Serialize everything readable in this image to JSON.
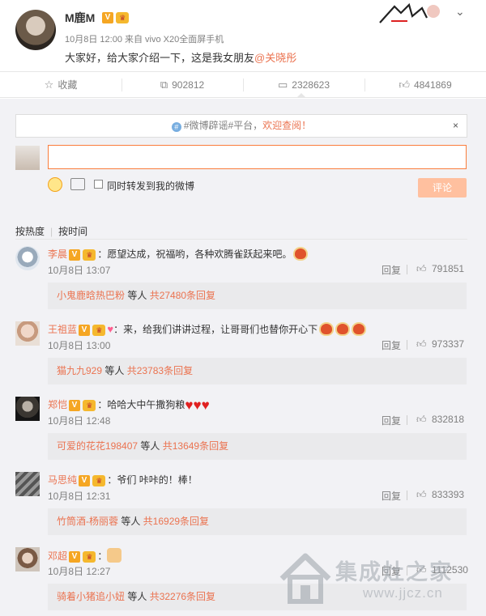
{
  "post": {
    "author": "M鹿M",
    "meta": "10月8日 12:00 来自 vivo X20全面屏手机",
    "text": "大家好，给大家介绍一下，这是我女朋友",
    "mention": "@关晓彤",
    "vip_badge": "V"
  },
  "actions": {
    "favorite": "收藏",
    "repost": "902812",
    "comment": "2328623",
    "like": "4841869"
  },
  "notice": {
    "text_before": "#微博辟谣#平台，",
    "accent": "欢迎查阅！",
    "close": "×"
  },
  "composer": {
    "input_value": "",
    "repost_label": "同时转发到我的微博",
    "submit": "评论"
  },
  "sort": {
    "hot": "按热度",
    "time": "按时间"
  },
  "comments": [
    {
      "name": "李晨",
      "text": "：愿望达成，祝福哟，各种欢腾雀跃起来吧。",
      "time": "10月8日 13:07",
      "reply": "回复",
      "likes": "791851",
      "sub_who": "小鬼鹿晗热巴粉",
      "sub_mid": " 等人 ",
      "sub_count": "共27480条回复"
    },
    {
      "name": "王祖蓝",
      "text": "：来，给我们讲讲过程，让哥哥们也替你开心下",
      "time": "10月8日 13:00",
      "reply": "回复",
      "likes": "973337",
      "sub_who": "猫九九929",
      "sub_mid": " 等人 ",
      "sub_count": "共23783条回复"
    },
    {
      "name": "郑恺",
      "text": "：哈哈大中午撒狗粮",
      "time": "10月8日 12:48",
      "reply": "回复",
      "likes": "832818",
      "sub_who": "可爱的花花198407",
      "sub_mid": " 等人 ",
      "sub_count": "共13649条回复"
    },
    {
      "name": "马思纯",
      "text": "：爷们 咔咔的！棒！",
      "time": "10月8日 12:31",
      "reply": "回复",
      "likes": "833393",
      "sub_who": "竹筒酒-杨丽蓉",
      "sub_mid": " 等人 ",
      "sub_count": "共16929条回复"
    },
    {
      "name": "邓超",
      "text": "：",
      "time": "10月8日 12:27",
      "reply": "回复",
      "likes": "1112530",
      "sub_who": "骑着小猪追小妞",
      "sub_mid": " 等人 ",
      "sub_count": "共32276条回复"
    }
  ],
  "watermark": {
    "brand": "集成灶之家",
    "url": "www.jjcz.cn"
  },
  "colors": {
    "accent": "#eb7350",
    "input_border": "#fa7d3c",
    "submit_bg": "#ffc09f",
    "panel_bg": "#f2f2f5"
  }
}
